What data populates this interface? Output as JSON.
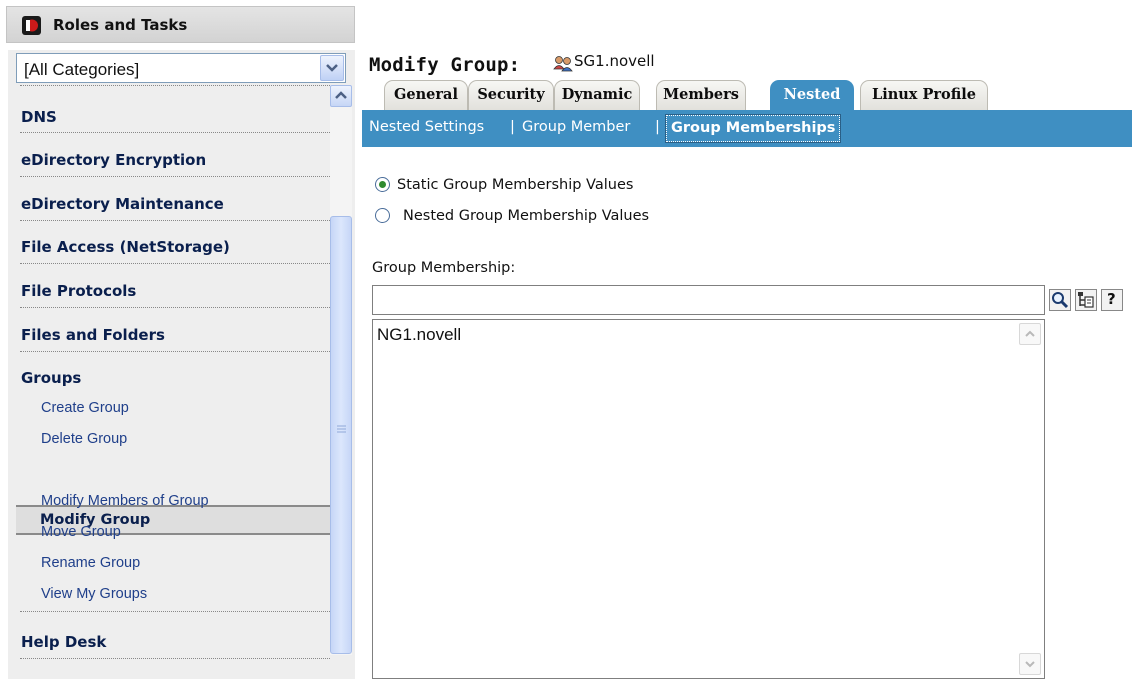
{
  "sidebar": {
    "title": "Roles and Tasks",
    "category_select": {
      "value": "[All Categories]"
    },
    "categories": [
      {
        "label": "DNS"
      },
      {
        "label": "eDirectory Encryption"
      },
      {
        "label": "eDirectory Maintenance"
      },
      {
        "label": "File Access (NetStorage)"
      },
      {
        "label": "File Protocols"
      },
      {
        "label": "Files and Folders"
      },
      {
        "label": "Groups"
      },
      {
        "label": "Help Desk"
      }
    ],
    "group_tasks": [
      {
        "label": "Create Group"
      },
      {
        "label": "Delete Group"
      },
      {
        "label": "Modify Group"
      },
      {
        "label": "Modify Members of Group"
      },
      {
        "label": "Move Group"
      },
      {
        "label": "Rename Group"
      },
      {
        "label": "View My Groups"
      }
    ],
    "selected_task": "Modify Group"
  },
  "main": {
    "title": "Modify Group:",
    "object_name": "SG1.novell",
    "tabs": [
      {
        "label": "General"
      },
      {
        "label": "Security"
      },
      {
        "label": "Dynamic"
      },
      {
        "label": "Members"
      },
      {
        "label": "Nested"
      },
      {
        "label": "Linux Profile"
      }
    ],
    "active_tab": "Nested",
    "subtabs": [
      {
        "label": "Nested Settings"
      },
      {
        "label": "Group Member"
      },
      {
        "label": "Group Memberships"
      }
    ],
    "active_subtab": "Group Memberships",
    "radio_options": [
      {
        "label": "Static Group Membership Values",
        "checked": true
      },
      {
        "label": "Nested Group Membership Values",
        "checked": false
      }
    ],
    "group_membership": {
      "label": "Group Membership:",
      "input_value": "",
      "items": [
        "NG1.novell"
      ],
      "help_button": "?"
    }
  },
  "colors": {
    "accent_blue": "#3f8fc2",
    "sidebar_bg": "#eeeeee",
    "category_text": "#0a1f4d",
    "task_text": "#1f3f8a"
  },
  "icons": [
    "novell-logo-icon",
    "select-arrow-icon",
    "group-icon",
    "search-icon",
    "browse-tree-icon",
    "help-icon",
    "scroll-up-icon",
    "scroll-down-icon"
  ]
}
